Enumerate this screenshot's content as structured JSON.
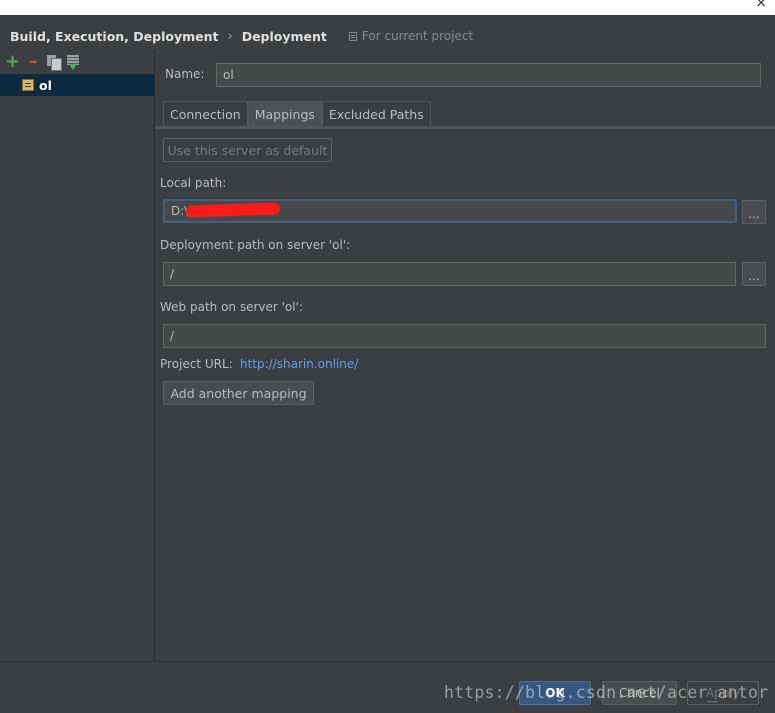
{
  "breadcrumb": {
    "parent": "Build, Execution, Deployment",
    "separator": "›",
    "current": "Deployment",
    "scope_note": "For current project"
  },
  "window": {
    "close_glyph": "×"
  },
  "sidebar": {
    "toolbar": {
      "add": "+",
      "remove": "–"
    },
    "servers": [
      {
        "label": "ol",
        "selected": true
      }
    ]
  },
  "form": {
    "name_label": "Name:",
    "name_value": "ol",
    "tabs": [
      {
        "label": "Connection",
        "active": false
      },
      {
        "label": "Mappings",
        "active": true
      },
      {
        "label": "Excluded Paths",
        "active": false
      }
    ],
    "default_button": "Use this server as default",
    "local_path_label": "Local path:",
    "local_path_value": "D:\\",
    "deployment_path_label": "Deployment path on server 'ol':",
    "deployment_path_value": "/",
    "web_path_label": "Web path on server 'ol':",
    "web_path_value": "/",
    "project_url_label": "Project URL:",
    "project_url_value": "http://sharin.online/",
    "add_mapping_button": "Add another mapping",
    "browse_label": "..."
  },
  "footer": {
    "ok": "OK",
    "cancel": "Cancel",
    "apply": "Apply"
  },
  "watermark": "https://blog.csdn.net/acer_antor",
  "colors": {
    "background": "#3c3f41",
    "selection": "#0d293e",
    "link": "#589df6",
    "focus_border": "#3d6185",
    "ok_button": "#365880"
  }
}
